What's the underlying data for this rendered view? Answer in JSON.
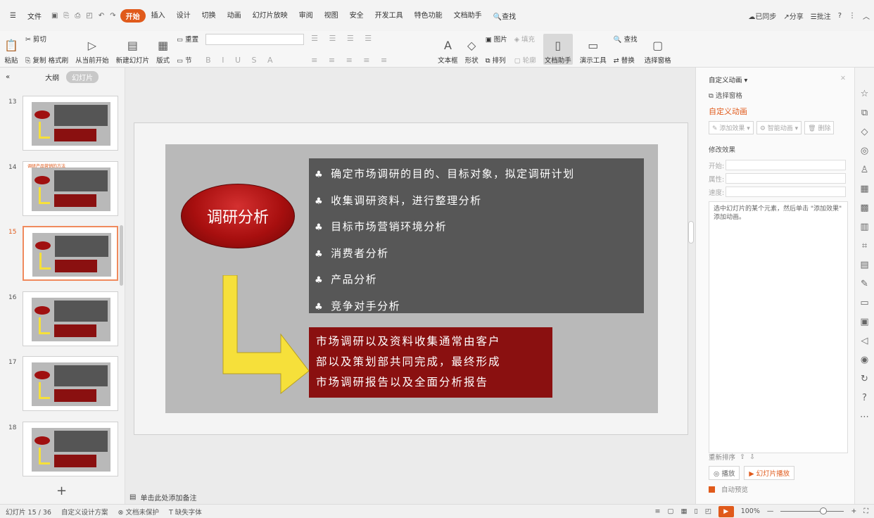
{
  "menubar": {
    "file": "文件",
    "tabs": [
      "开始",
      "插入",
      "设计",
      "切换",
      "动画",
      "幻灯片放映",
      "审阅",
      "视图",
      "安全",
      "开发工具",
      "特色功能",
      "文档助手"
    ],
    "active_tab": "开始",
    "search": "查找",
    "sync": "已同步",
    "share": "分享",
    "comment": "批注"
  },
  "ribbon": {
    "paste": "粘贴",
    "cut": "剪切",
    "copy": "复制",
    "format_painter": "格式刷",
    "play_from_current": "从当前开始",
    "new_slide": "新建幻灯片",
    "layout": "版式",
    "reset": "重置",
    "section": "节",
    "textbox": "文本框",
    "shape": "形状",
    "picture": "图片",
    "arrange": "排列",
    "fill": "填充",
    "outline": "轮廓",
    "doc_assistant": "文档助手",
    "presenter_tools": "演示工具",
    "find": "查找",
    "replace": "替换",
    "select_pane": "选择窗格"
  },
  "leftpanel": {
    "outline_tab": "大纲",
    "slides_tab": "幻灯片",
    "thumbnails": [
      {
        "num": "13",
        "title": ""
      },
      {
        "num": "14",
        "title": "调研产品营销的方法"
      },
      {
        "num": "15",
        "title": ""
      },
      {
        "num": "16",
        "title": ""
      },
      {
        "num": "17",
        "title": ""
      },
      {
        "num": "18",
        "title": ""
      }
    ],
    "selected": "15"
  },
  "slide": {
    "oval_text": "调研分析",
    "bullets": [
      "确定市场调研的目的、目标对象，拟定调研计划",
      "收集调研资料，进行整理分析",
      "目标市场营销环境分析",
      "消费者分析",
      "产品分析",
      "竞争对手分析"
    ],
    "bullet_symbol": "♣",
    "red_text": [
      "市场调研以及资料收集通常由客户",
      "部以及策划部共同完成，最终形成",
      "市场调研报告以及全面分析报告"
    ]
  },
  "notes": {
    "placeholder": "单击此处添加备注"
  },
  "rightpanel": {
    "title": "自定义动画",
    "select_pane": "选择窗格",
    "section_title": "自定义动画",
    "add_effect": "添加效果",
    "smart_anim": "智能动画",
    "delete": "删除",
    "modify": "修改效果",
    "start": "开始:",
    "property": "属性:",
    "speed": "速度:",
    "hint": "选中幻灯片的某个元素，然后单击 \"添加效果\" 添加动画。",
    "reorder": "重新排序",
    "play": "播放",
    "slideshow": "幻灯片播放",
    "auto_preview": "自动预览"
  },
  "statusbar": {
    "slide_index": "幻灯片 15 / 36",
    "theme": "自定义设计方案",
    "doc_protect": "文档未保护",
    "missing_font": "缺失字体",
    "zoom": "100%"
  },
  "colors": {
    "accent": "#e05a1b",
    "slide_dark": "#575757",
    "slide_red": "#8a1010",
    "arrow_yellow": "#f6e03a"
  }
}
